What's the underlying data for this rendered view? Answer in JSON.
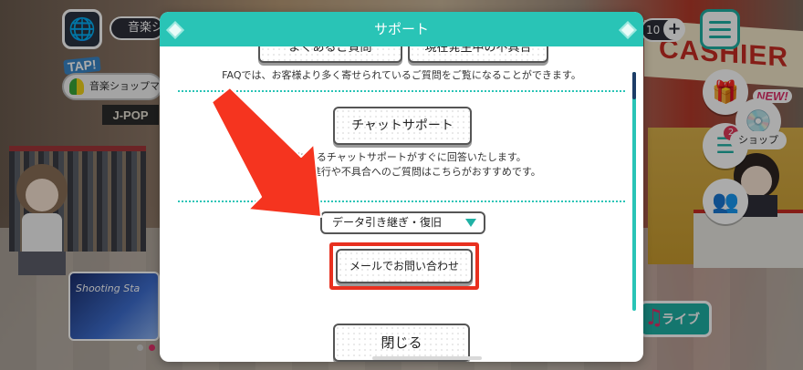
{
  "hud": {
    "stage_label": "音楽ショ",
    "tap_label": "TAP!",
    "shop_hint": "音楽ショップマ",
    "count_value": "10",
    "plus_label": "+",
    "new_badge": "NEW!",
    "shop_label": "ショップ",
    "shop_badge_count": "2",
    "live_label": "ライブ",
    "cashier_sign": "CASHIER",
    "jpop_sign": "J-POP",
    "banner_text": "Shooting Sta"
  },
  "dialog": {
    "title": "サポート",
    "faq_button": "よくあるご質問",
    "news_button": "現在発生中の不具合",
    "faq_description": "FAQでは、お客様より多く寄せられているご質問をご覧になることができます。",
    "chat_button": "チャットサポート",
    "chat_description_1": "によるチャットサポートがすぐに回答いたします。",
    "chat_description_2a": "ゲーム",
    "chat_description_2b": "進行や不具合へのご質問はこちらがおすすめです。",
    "dropdown_value": "データ引き継ぎ・復旧",
    "mail_button": "メールでお問い合わせ",
    "close_button": "閉じる"
  },
  "colors": {
    "accent": "#29c4b6",
    "highlight": "#e8301f"
  }
}
